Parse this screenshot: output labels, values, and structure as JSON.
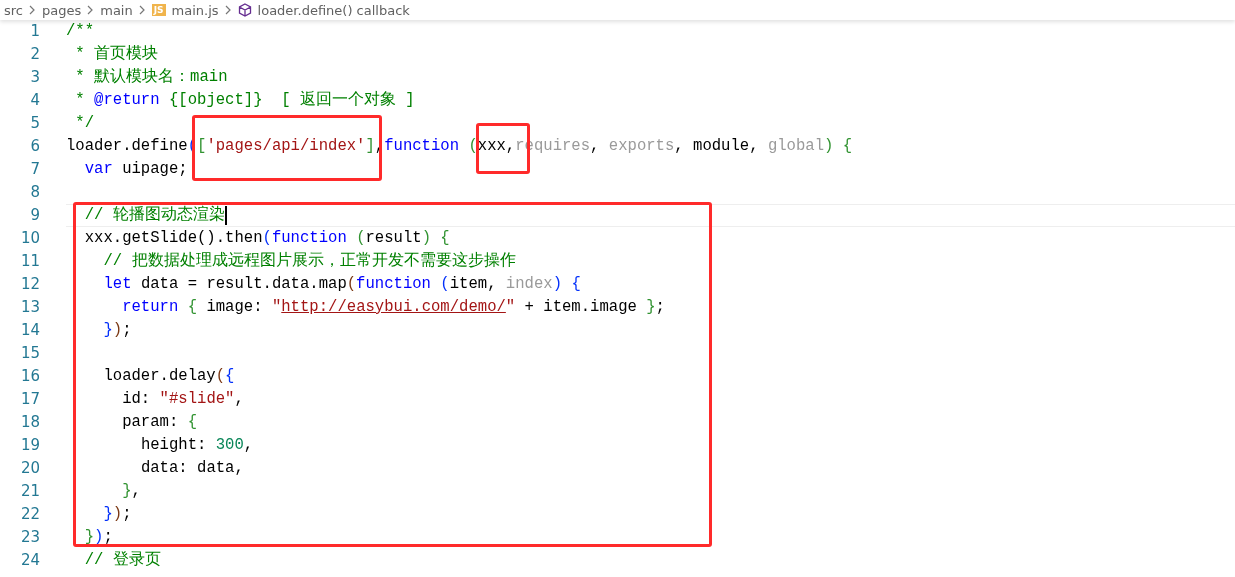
{
  "breadcrumb": [
    {
      "kind": "folder",
      "text": "src"
    },
    {
      "kind": "folder",
      "text": "pages"
    },
    {
      "kind": "folder",
      "text": "main"
    },
    {
      "kind": "file",
      "badge": "JS",
      "text": "main.js"
    },
    {
      "kind": "symbol",
      "text": "loader.define() callback"
    }
  ],
  "lines": [
    {
      "number": "1",
      "current": false,
      "tokens": [
        {
          "kind": "comment",
          "text": "/**"
        }
      ]
    },
    {
      "number": "2",
      "current": false,
      "tokens": [
        {
          "kind": "comment",
          "text": " * 首页模块"
        }
      ]
    },
    {
      "number": "3",
      "current": false,
      "tokens": [
        {
          "kind": "comment",
          "text": " * 默认模块名：main"
        }
      ]
    },
    {
      "number": "4",
      "current": false,
      "tokens": [
        {
          "kind": "comment",
          "text": " * "
        },
        {
          "kind": "doctag",
          "text": "@return"
        },
        {
          "kind": "comment",
          "text": " {[object]}  [ 返回一个对象 ]"
        }
      ]
    },
    {
      "number": "5",
      "current": false,
      "tokens": [
        {
          "kind": "comment",
          "text": " */"
        }
      ]
    },
    {
      "number": "6",
      "current": false,
      "tokens": [
        {
          "kind": "plain",
          "text": "loader.define"
        },
        {
          "kind": "bracket1",
          "text": "("
        },
        {
          "kind": "bracket2",
          "text": "["
        },
        {
          "kind": "string",
          "text": "'pages/api/index'"
        },
        {
          "kind": "bracket2",
          "text": "]"
        },
        {
          "kind": "plain",
          "text": ","
        },
        {
          "kind": "keyword",
          "text": "function"
        },
        {
          "kind": "bracket2",
          "text": " ("
        },
        {
          "kind": "plain",
          "text": "xxx,"
        },
        {
          "kind": "unused",
          "text": "requires"
        },
        {
          "kind": "plain",
          "text": ", "
        },
        {
          "kind": "unused",
          "text": "exports"
        },
        {
          "kind": "plain",
          "text": ", module, "
        },
        {
          "kind": "unused",
          "text": "global"
        },
        {
          "kind": "bracket2",
          "text": ")"
        },
        {
          "kind": "bracket2",
          "text": " {"
        }
      ]
    },
    {
      "number": "7",
      "current": false,
      "tokens": [
        {
          "kind": "keyword",
          "text": "  var"
        },
        {
          "kind": "plain",
          "text": " uipage;"
        }
      ]
    },
    {
      "number": "8",
      "current": false
    },
    {
      "number": "9",
      "current": true,
      "tokens": [
        {
          "kind": "comment",
          "text": "  // 轮播图动态渲染"
        }
      ]
    },
    {
      "number": "10",
      "current": false,
      "tokens": [
        {
          "kind": "plain",
          "text": "  xxx.getSlide().then"
        },
        {
          "kind": "bracket1",
          "text": "("
        },
        {
          "kind": "keyword",
          "text": "function"
        },
        {
          "kind": "bracket2",
          "text": " ("
        },
        {
          "kind": "plain",
          "text": "result"
        },
        {
          "kind": "bracket2",
          "text": ")"
        },
        {
          "kind": "bracket2",
          "text": " {"
        }
      ]
    },
    {
      "number": "11",
      "current": false,
      "tokens": [
        {
          "kind": "comment",
          "text": "    // 把数据处理成远程图片展示，正常开发不需要这步操作"
        }
      ]
    },
    {
      "number": "12",
      "current": false,
      "tokens": [
        {
          "kind": "keyword",
          "text": "    let"
        },
        {
          "kind": "plain",
          "text": " data = result.data.map"
        },
        {
          "kind": "bracket3",
          "text": "("
        },
        {
          "kind": "keyword",
          "text": "function"
        },
        {
          "kind": "bracket1",
          "text": " ("
        },
        {
          "kind": "plain",
          "text": "item, "
        },
        {
          "kind": "unused",
          "text": "index"
        },
        {
          "kind": "bracket1",
          "text": ")"
        },
        {
          "kind": "bracket1",
          "text": " {"
        }
      ]
    },
    {
      "number": "13",
      "current": false,
      "tokens": [
        {
          "kind": "keyword",
          "text": "      return"
        },
        {
          "kind": "bracket2",
          "text": " {"
        },
        {
          "kind": "plain",
          "text": " image: "
        },
        {
          "kind": "string",
          "text": "\""
        },
        {
          "kind": "link",
          "text": "http://easybui.com/demo/"
        },
        {
          "kind": "string",
          "text": "\""
        },
        {
          "kind": "plain",
          "text": " + item.image "
        },
        {
          "kind": "bracket2",
          "text": "}"
        },
        {
          "kind": "plain",
          "text": ";"
        }
      ]
    },
    {
      "number": "14",
      "current": false,
      "tokens": [
        {
          "kind": "bracket1",
          "text": "    }"
        },
        {
          "kind": "bracket3",
          "text": ")"
        },
        {
          "kind": "plain",
          "text": ";"
        }
      ]
    },
    {
      "number": "15",
      "current": false
    },
    {
      "number": "16",
      "current": false,
      "tokens": [
        {
          "kind": "plain",
          "text": "    loader.delay"
        },
        {
          "kind": "bracket3",
          "text": "("
        },
        {
          "kind": "bracket1",
          "text": "{"
        }
      ]
    },
    {
      "number": "17",
      "current": false,
      "tokens": [
        {
          "kind": "plain",
          "text": "      id: "
        },
        {
          "kind": "string",
          "text": "\"#slide\""
        },
        {
          "kind": "plain",
          "text": ","
        }
      ]
    },
    {
      "number": "18",
      "current": false,
      "tokens": [
        {
          "kind": "plain",
          "text": "      param: "
        },
        {
          "kind": "bracket2",
          "text": "{"
        }
      ]
    },
    {
      "number": "19",
      "current": false,
      "tokens": [
        {
          "kind": "plain",
          "text": "        height: "
        },
        {
          "kind": "number",
          "text": "300"
        },
        {
          "kind": "plain",
          "text": ","
        }
      ]
    },
    {
      "number": "20",
      "current": false,
      "tokens": [
        {
          "kind": "plain",
          "text": "        data: data,"
        }
      ]
    },
    {
      "number": "21",
      "current": false,
      "tokens": [
        {
          "kind": "bracket2",
          "text": "      }"
        },
        {
          "kind": "plain",
          "text": ","
        }
      ]
    },
    {
      "number": "22",
      "current": false,
      "tokens": [
        {
          "kind": "bracket1",
          "text": "    }"
        },
        {
          "kind": "bracket3",
          "text": ")"
        },
        {
          "kind": "plain",
          "text": ";"
        }
      ]
    },
    {
      "number": "23",
      "current": false,
      "tokens": [
        {
          "kind": "bracket2",
          "text": "  }"
        },
        {
          "kind": "bracket1",
          "text": ")"
        },
        {
          "kind": "plain",
          "text": ";"
        }
      ]
    },
    {
      "number": "24",
      "current": false,
      "tokens": [
        {
          "kind": "comment",
          "text": "  // 登录页"
        }
      ]
    }
  ]
}
